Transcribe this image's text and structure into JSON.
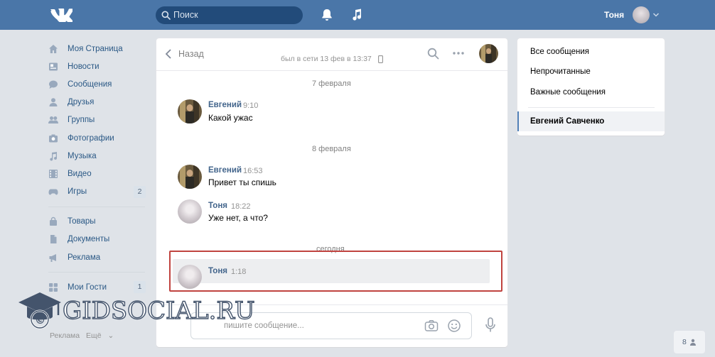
{
  "header": {
    "search_placeholder": "Поиск",
    "user_name": "Тоня",
    "brand_color": "#4a76a8"
  },
  "leftnav": {
    "items": [
      {
        "label": "Моя Страница",
        "icon": "home-icon"
      },
      {
        "label": "Новости",
        "icon": "news-icon"
      },
      {
        "label": "Сообщения",
        "icon": "messages-icon"
      },
      {
        "label": "Друзья",
        "icon": "friends-icon"
      },
      {
        "label": "Группы",
        "icon": "groups-icon"
      },
      {
        "label": "Фотографии",
        "icon": "photos-icon"
      },
      {
        "label": "Музыка",
        "icon": "music-icon"
      },
      {
        "label": "Видео",
        "icon": "video-icon"
      },
      {
        "label": "Игры",
        "icon": "games-icon",
        "badge": "2"
      }
    ],
    "items2": [
      {
        "label": "Товары",
        "icon": "market-icon"
      },
      {
        "label": "Документы",
        "icon": "documents-icon"
      },
      {
        "label": "Реклама",
        "icon": "ads-icon"
      }
    ],
    "items3": [
      {
        "label": "Мои Гости",
        "icon": "guests-icon",
        "badge": "1"
      }
    ],
    "footer": {
      "link1": "Реклама",
      "link2": "Ещё"
    }
  },
  "chat": {
    "back_label": "Назад",
    "status": "был в сети 13 фев в 13:37",
    "date1": "7 февраля",
    "date2": "8 февраля",
    "date3": "сегодня",
    "messages": [
      {
        "author": "Евгений",
        "time": "9:10",
        "text": "Какой ужас"
      },
      {
        "author": "Евгений",
        "time": "16:53",
        "text": "Привет ты спишь"
      },
      {
        "author": "Тоня",
        "time": "18:22",
        "text": "Уже нет, а что?"
      },
      {
        "author": "Тоня",
        "time": "1:18",
        "text": ""
      }
    ],
    "composer_placeholder": "пишите сообщение..."
  },
  "rightpanel": {
    "all": "Все сообщения",
    "unread": "Непрочитанные",
    "important": "Важные сообщения",
    "active": "Евгений Савченко"
  },
  "watermark": {
    "text": "GIDSOCIAL.RU"
  },
  "counter": {
    "value": "8"
  }
}
